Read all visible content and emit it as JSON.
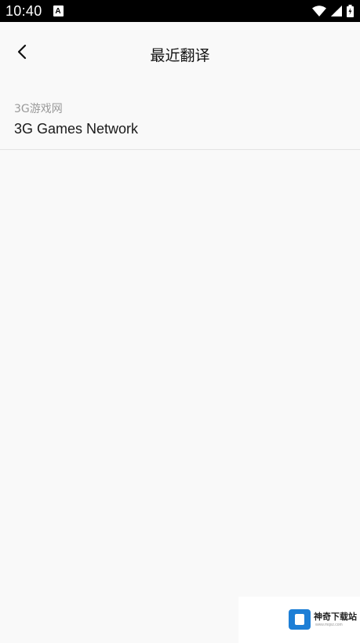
{
  "status_bar": {
    "time": "10:40",
    "notification_icon": "A",
    "icons": [
      "wifi-icon",
      "signal-icon",
      "battery-icon"
    ]
  },
  "header": {
    "title": "最近翻译",
    "back_icon": "chevron-left-icon"
  },
  "history": [
    {
      "source": "3G游戏网",
      "translation": "3G Games Network"
    }
  ],
  "watermark": {
    "name": "神奇下载站",
    "url": "www.mqxz.com"
  },
  "colors": {
    "status_bar": "#000000",
    "background": "#f9f9f9",
    "divider": "#e3e3e3",
    "secondary_text": "#9a9a9a",
    "logo_blue": "#1e7fd6"
  }
}
